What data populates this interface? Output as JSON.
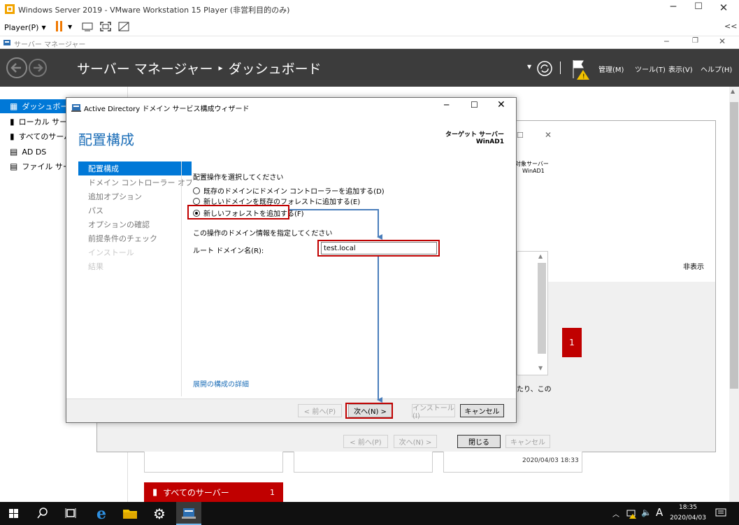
{
  "vm": {
    "title": "Windows Server 2019 - VMware Workstation 15 Player (非営利目的のみ)",
    "player_menu": "Player(P)",
    "collapse": "<<"
  },
  "sm": {
    "window_title": "サーバー マネージャー",
    "breadcrumb_app": "サーバー マネージャー",
    "breadcrumb_sep": "▸",
    "breadcrumb_page": "ダッシュボード",
    "menus": [
      "管理(M)",
      "ツール(T)",
      "表示(V)",
      "ヘルプ(H)"
    ],
    "nav": [
      "ダッシュボード",
      "ローカル サーバー",
      "すべてのサーバー",
      "AD DS",
      "ファイル サービス"
    ],
    "bg_dialog": {
      "target_label": "対象サーバー",
      "target_value": "WinAD1",
      "hide": "非表示",
      "text_fragment": "たり、この",
      "prev": "< 前へ(P)",
      "next": "次へ(N) >",
      "close": "閉じる",
      "cancel": "キャンセル"
    },
    "tile_count": "1",
    "timestamp": "2020/04/03 18:33",
    "all_servers_tile": "すべてのサーバー",
    "all_servers_count": "1"
  },
  "wizard": {
    "title": "Active Directory ドメイン サービス構成ウィザード",
    "heading": "配置構成",
    "target_label": "ターゲット サーバー",
    "target_value": "WinAD1",
    "nav": [
      {
        "label": "配置構成",
        "state": "active"
      },
      {
        "label": "ドメイン コントローラー オプション",
        "state": "normal"
      },
      {
        "label": "追加オプション",
        "state": "normal"
      },
      {
        "label": "パス",
        "state": "normal"
      },
      {
        "label": "オプションの確認",
        "state": "normal"
      },
      {
        "label": "前提条件のチェック",
        "state": "normal"
      },
      {
        "label": "インストール",
        "state": "disabled"
      },
      {
        "label": "結果",
        "state": "disabled"
      }
    ],
    "select_label": "配置操作を選択してください",
    "options": [
      {
        "label": "既存のドメインにドメイン コントローラーを追加する(D)",
        "selected": false
      },
      {
        "label": "新しいドメインを既存のフォレストに追加する(E)",
        "selected": false
      },
      {
        "label": "新しいフォレストを追加する(F)",
        "selected": true
      }
    ],
    "domain_info_label": "この操作のドメイン情報を指定してください",
    "root_domain_label": "ルート ドメイン名(R):",
    "root_domain_value": "test.local",
    "more_link": "展開の構成の詳細",
    "buttons": {
      "prev": "< 前へ(P)",
      "next": "次へ(N) >",
      "install": "インストール(I)",
      "cancel": "キャンセル"
    }
  },
  "taskbar": {
    "ime": "A",
    "time": "18:35",
    "date": "2020/04/03"
  },
  "colors": {
    "sm_header": "#3c3c3c",
    "accent_blue": "#0078d7",
    "annotation_red": "#c00000",
    "arrow_blue": "#4a7ebb",
    "tile_red": "#c00000"
  }
}
